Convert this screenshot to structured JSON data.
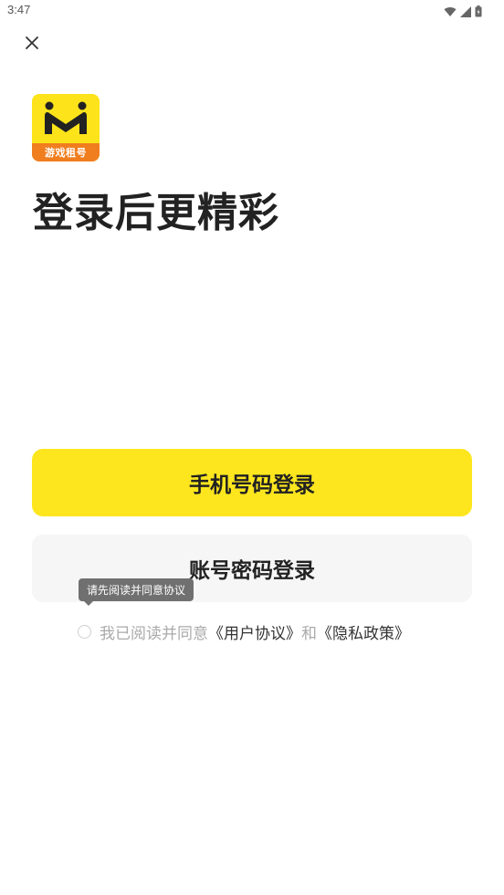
{
  "status_bar": {
    "time": "3:47"
  },
  "logo": {
    "text": "游戏租号"
  },
  "headline": "登录后更精彩",
  "buttons": {
    "phone_login": "手机号码登录",
    "account_login": "账号密码登录"
  },
  "tooltip": "请先阅读并同意协议",
  "agreement": {
    "prefix": "我已阅读并同意",
    "user_agreement": "《用户协议》",
    "conjunction": "和",
    "privacy_policy": "《隐私政策》"
  },
  "colors": {
    "primary_button": "#fde61e",
    "secondary_button": "#f6f6f6",
    "logo_bg": "#fde319",
    "logo_band": "#f07e1f",
    "tooltip_bg": "#707070"
  },
  "icons": {
    "close": "close-icon",
    "wifi": "wifi-icon",
    "signal": "signal-icon",
    "battery": "battery-icon"
  }
}
